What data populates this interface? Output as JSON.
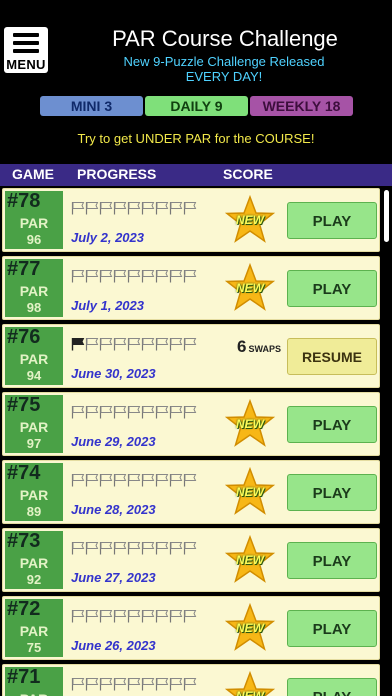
{
  "header": {
    "menu_label": "MENU",
    "title": "PAR Course Challenge",
    "subtitle_line1": "New 9-Puzzle Challenge Released",
    "subtitle_line2": "EVERY DAY!"
  },
  "tabs": [
    {
      "label": "MINI 3",
      "bg": "#6d8fd0",
      "fg": "#102a6a",
      "selected": false
    },
    {
      "label": "DAILY 9",
      "bg": "#7fe07a",
      "fg": "#10400f",
      "selected": true
    },
    {
      "label": "WEEKLY 18",
      "bg": "#a653a6",
      "fg": "#3d0e3d",
      "selected": false
    }
  ],
  "tagline": "Try to get UNDER PAR for the COURSE!",
  "columns": {
    "game": "GAME",
    "progress": "PROGRESS",
    "score": "SCORE"
  },
  "rows": [
    {
      "num": "#78",
      "par_label": "PAR",
      "par": "96",
      "date": "July 2, 2023",
      "status": "new",
      "star_label": "NEW",
      "button": "PLAY",
      "flags_filled": 0
    },
    {
      "num": "#77",
      "par_label": "PAR",
      "par": "98",
      "date": "July 1, 2023",
      "status": "new",
      "star_label": "NEW",
      "button": "PLAY",
      "flags_filled": 0
    },
    {
      "num": "#76",
      "par_label": "PAR",
      "par": "94",
      "date": "June 30, 2023",
      "status": "in-progress",
      "swaps": "6",
      "swaps_label": "SWAPS",
      "button": "RESUME",
      "flags_filled": 1
    },
    {
      "num": "#75",
      "par_label": "PAR",
      "par": "97",
      "date": "June 29, 2023",
      "status": "new",
      "star_label": "NEW",
      "button": "PLAY",
      "flags_filled": 0
    },
    {
      "num": "#74",
      "par_label": "PAR",
      "par": "89",
      "date": "June 28, 2023",
      "status": "new",
      "star_label": "NEW",
      "button": "PLAY",
      "flags_filled": 0
    },
    {
      "num": "#73",
      "par_label": "PAR",
      "par": "92",
      "date": "June 27, 2023",
      "status": "new",
      "star_label": "NEW",
      "button": "PLAY",
      "flags_filled": 0
    },
    {
      "num": "#72",
      "par_label": "PAR",
      "par": "75",
      "date": "June 26, 2023",
      "status": "new",
      "star_label": "NEW",
      "button": "PLAY",
      "flags_filled": 0
    },
    {
      "num": "#71",
      "par_label": "PAR",
      "par": "",
      "date": "",
      "status": "new",
      "star_label": "NEW",
      "button": "PLAY",
      "flags_filled": 0
    }
  ],
  "flags_per_row": 9,
  "colors": {
    "row_bg": "#fbf8d2",
    "badge_green": "#4aa146",
    "star_gold": "#f7b716",
    "play_green": "#97e58a",
    "resume_yellow": "#f0ec98",
    "header_purple": "#3a2a86"
  }
}
